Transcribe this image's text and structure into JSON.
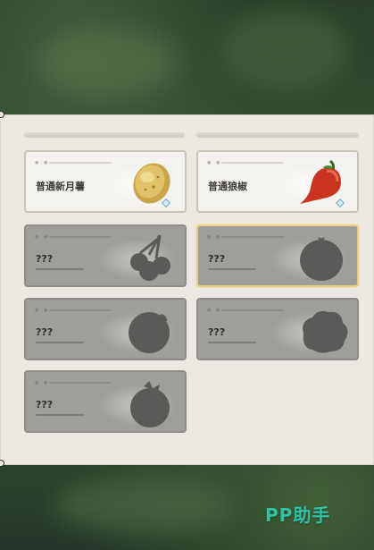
{
  "cards": [
    {
      "name": "普通新月薯",
      "state": "unlocked",
      "icon": "potato-icon"
    },
    {
      "name": "普通狼椒",
      "state": "unlocked",
      "icon": "chili-pepper-icon"
    },
    {
      "name": "???",
      "state": "locked",
      "icon": "cherries-silhouette-icon"
    },
    {
      "name": "???",
      "state": "locked-selected",
      "icon": "tomato-silhouette-icon"
    },
    {
      "name": "???",
      "state": "locked",
      "icon": "round-fruit-silhouette-icon"
    },
    {
      "name": "???",
      "state": "locked",
      "icon": "cabbage-silhouette-icon"
    },
    {
      "name": "???",
      "state": "locked",
      "icon": "berry-silhouette-icon"
    }
  ],
  "watermark": "PP助手",
  "colors": {
    "panel": "#ece9e2",
    "locked_card": "#a09e9a",
    "selected_border": "#e6d287",
    "watermark": "#2fc1a4"
  }
}
